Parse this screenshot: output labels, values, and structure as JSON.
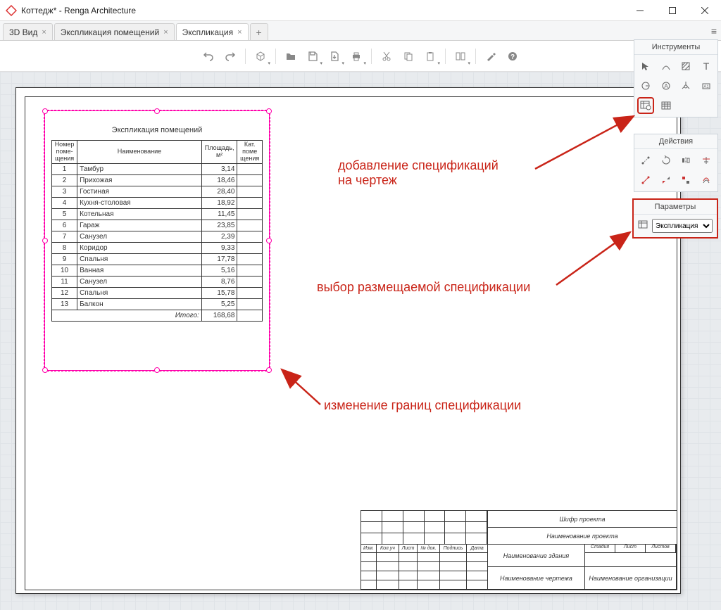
{
  "window": {
    "title": "Коттедж* - Renga Architecture"
  },
  "tabs": [
    {
      "label": "3D Вид",
      "closable": true,
      "active": false
    },
    {
      "label": "Экспликация помещений",
      "closable": true,
      "active": false
    },
    {
      "label": "Экспликация",
      "closable": true,
      "active": true
    }
  ],
  "panels": {
    "tools": {
      "title": "Инструменты"
    },
    "actions": {
      "title": "Действия"
    },
    "params": {
      "title": "Параметры",
      "select_value": "Экспликация"
    }
  },
  "spec": {
    "title": "Экспликация помещений",
    "headers": {
      "num": "Номер\nпоме-\nщения",
      "name": "Наименование",
      "area": "Площадь,\nм²",
      "cat": "Кат.\nпоме\nщения"
    },
    "rows": [
      {
        "n": "1",
        "name": "Тамбур",
        "area": "3,14"
      },
      {
        "n": "2",
        "name": "Прихожая",
        "area": "18,46"
      },
      {
        "n": "3",
        "name": "Гостиная",
        "area": "28,40"
      },
      {
        "n": "4",
        "name": "Кухня-столовая",
        "area": "18,92"
      },
      {
        "n": "5",
        "name": "Котельная",
        "area": "11,45"
      },
      {
        "n": "6",
        "name": "Гараж",
        "area": "23,85"
      },
      {
        "n": "7",
        "name": "Санузел",
        "area": "2,39"
      },
      {
        "n": "8",
        "name": "Коридор",
        "area": "9,33"
      },
      {
        "n": "9",
        "name": "Спальня",
        "area": "17,78"
      },
      {
        "n": "10",
        "name": "Ванная",
        "area": "5,16"
      },
      {
        "n": "11",
        "name": "Санузел",
        "area": "8,76"
      },
      {
        "n": "12",
        "name": "Спальня",
        "area": "15,78"
      },
      {
        "n": "13",
        "name": "Балкон",
        "area": "5,25"
      }
    ],
    "total_label": "Итого:",
    "total": "168,68"
  },
  "stamp": {
    "code": "Шифр проекта",
    "project": "Наименование проекта",
    "building": "Наименование здания",
    "drawing": "Наименование чертежа",
    "org": "Наименование организации",
    "cols": {
      "izm": "Изм.",
      "kol": "Кол.уч",
      "list": "Лист",
      "ndok": "№ док.",
      "sign": "Подпись",
      "date": "Дата"
    },
    "sheet_hdr": {
      "stage": "Стадия",
      "sheet": "Лист",
      "sheets": "Листов"
    }
  },
  "annotations": {
    "add": "добавление спецификаций\nна чертеж",
    "choose": "выбор размещаемой спецификации",
    "resize": "изменение границ спецификации"
  }
}
